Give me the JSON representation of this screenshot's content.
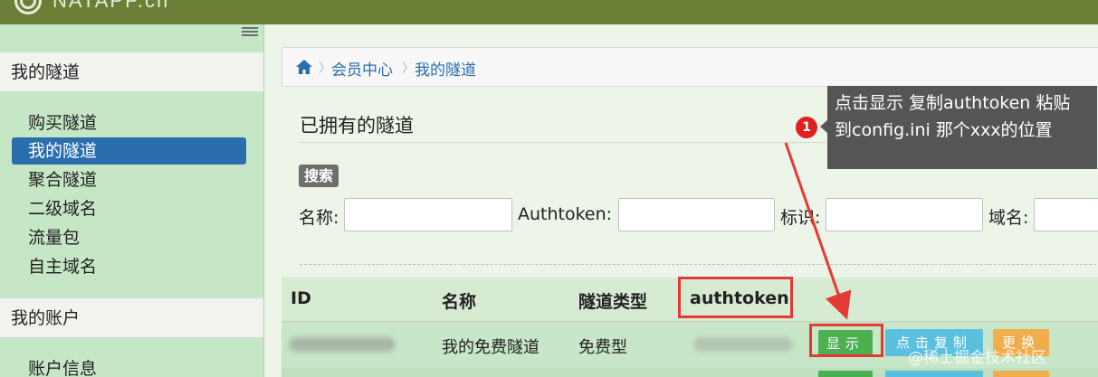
{
  "app": {
    "logo_text": "NATAPP.cn"
  },
  "sidebar": {
    "sections": [
      {
        "title": "我的隧道",
        "items": [
          "购买隧道",
          "我的隧道",
          "聚合隧道",
          "二级域名",
          "流量包",
          "自主域名"
        ]
      },
      {
        "title": "我的账户",
        "items": [
          "账户信息"
        ]
      }
    ],
    "active_item": "我的隧道"
  },
  "breadcrumb": [
    "会员中心",
    "我的隧道"
  ],
  "page": {
    "title": "已拥有的隧道"
  },
  "search": {
    "badge": "搜索",
    "fields": [
      {
        "label": "名称:",
        "value": ""
      },
      {
        "label": "Authtoken:",
        "value": ""
      },
      {
        "label": "标识:",
        "value": ""
      },
      {
        "label": "域名:",
        "value": ""
      }
    ]
  },
  "table": {
    "columns": [
      "ID",
      "名称",
      "隧道类型",
      "authtoken"
    ],
    "rows": [
      {
        "name": "我的免费隧道",
        "type": "免费型"
      }
    ],
    "actions": {
      "show": "显示",
      "copy": "点击复制",
      "change": "更换"
    }
  },
  "annotation": {
    "step": "1",
    "line1": "点击显示 复制authtoken 粘贴",
    "line2": "到config.ini 那个xxx的位置"
  },
  "watermark": "@稀土掘金技术社区",
  "colors": {
    "topbar": "#6b7f37",
    "sidebar": "#c6e7c6",
    "active_item": "#2a6ead",
    "show_button": "#4caf50",
    "copy_button": "#5bc0de",
    "change_button": "#f0ad4e",
    "highlight": "#e53935"
  }
}
